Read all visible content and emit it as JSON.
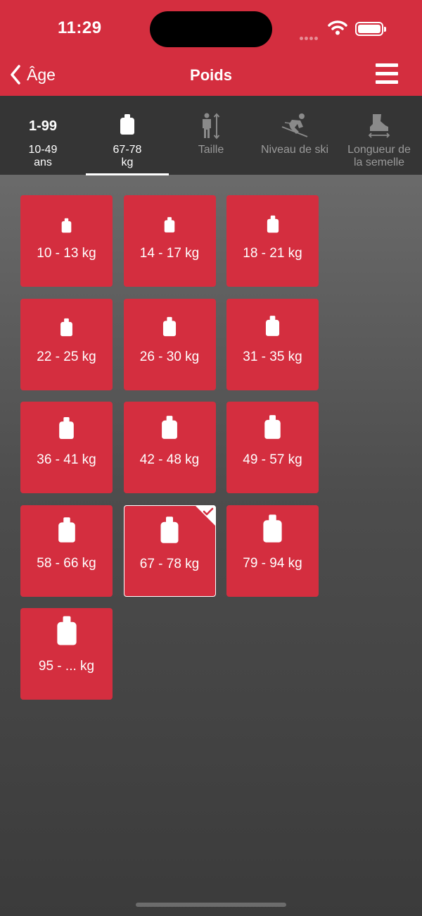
{
  "status_bar": {
    "time": "11:29"
  },
  "nav": {
    "back_label": "Âge",
    "title": "Poids"
  },
  "tabs": [
    {
      "badge": "1-99",
      "label": "10-49\nans",
      "icon": "age-badge",
      "state": "done"
    },
    {
      "label": "67-78\nkg",
      "icon": "weight-icon",
      "state": "active"
    },
    {
      "label": "Taille",
      "icon": "height-icon",
      "state": "pending"
    },
    {
      "label": "Niveau de ski",
      "icon": "skier-icon",
      "state": "pending"
    },
    {
      "label": "Longueur de\nla semelle",
      "icon": "boot-icon",
      "state": "pending"
    }
  ],
  "weights": [
    {
      "label": "10 - 13 kg"
    },
    {
      "label": "14 - 17 kg"
    },
    {
      "label": "18 - 21 kg"
    },
    {
      "label": "22 - 25 kg"
    },
    {
      "label": "26 - 30 kg"
    },
    {
      "label": "31 - 35 kg"
    },
    {
      "label": "36 - 41 kg"
    },
    {
      "label": "42 - 48 kg"
    },
    {
      "label": "49 - 57 kg"
    },
    {
      "label": "58 - 66 kg"
    },
    {
      "label": "67 - 78 kg",
      "selected": true
    },
    {
      "label": "79 - 94 kg"
    },
    {
      "label": "95 - ... kg"
    }
  ],
  "colors": {
    "accent": "#d42e3f",
    "tab_bar": "#353535"
  }
}
